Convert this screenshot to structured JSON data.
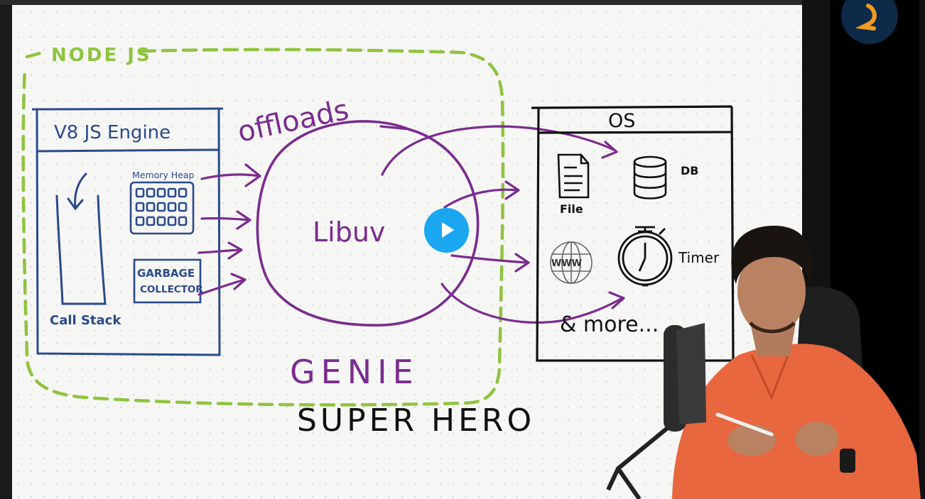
{
  "diagram": {
    "node_label": "NODE JS",
    "v8_title": "V8 JS Engine",
    "memory_heap": "Memory Heap",
    "garbage_line1": "GARBAGE",
    "garbage_line2": "COLLECTOR",
    "call_stack": "Call Stack",
    "offloads": "offloads",
    "libuv": "Libuv",
    "genie": "GENIE",
    "super_hero": "SUPER HERO",
    "os_title": "OS",
    "file": "File",
    "db": "DB",
    "timer": "Timer",
    "more": "& more...",
    "www": "WWW"
  },
  "colors": {
    "node_dashed": "#8fc43f",
    "v8_blue": "#2a4a8c",
    "libuv_purple": "#7a2c8f",
    "ink": "#111111",
    "play": "#1ba6f2",
    "logo_bg": "#0d2a48",
    "logo_mark": "#f29a1f",
    "shirt": "#e8673f"
  },
  "player": {
    "play_icon": "play-icon"
  }
}
